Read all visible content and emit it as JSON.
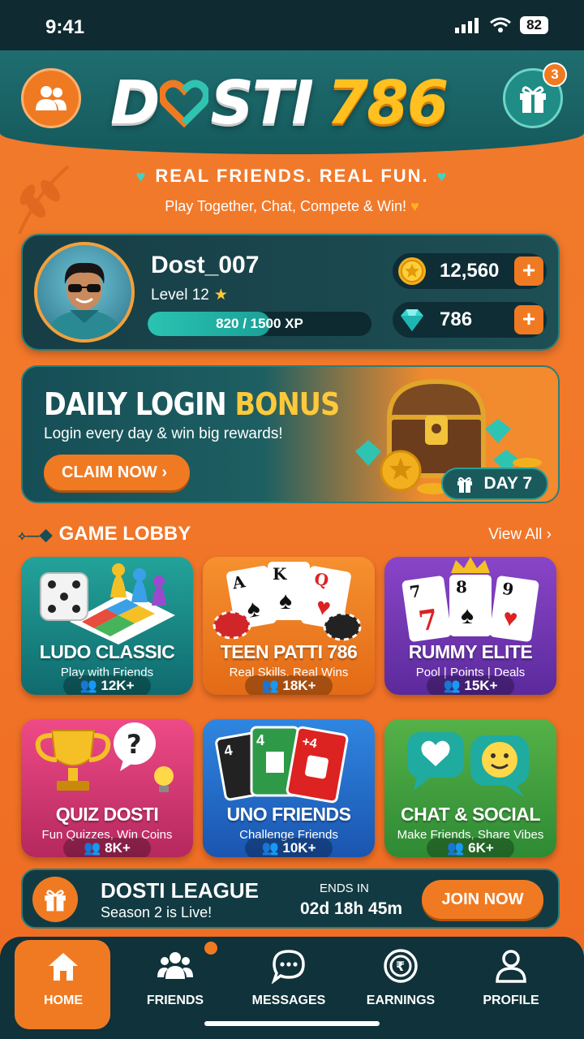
{
  "status_bar": {
    "time": "9:41",
    "battery": "82"
  },
  "header": {
    "logo_part1": "D",
    "logo_part2": "STI",
    "logo_number": "786",
    "gift_badge": "3"
  },
  "tagline": {
    "main": "REAL FRIENDS. REAL FUN.",
    "sub": "Play Together, Chat, Compete & Win!"
  },
  "profile": {
    "username": "Dost_007",
    "level": "Level 12",
    "xp_text": "820 / 1500 XP",
    "xp_progress": 0.547,
    "coins": "12,560",
    "gems": "786"
  },
  "daily_bonus": {
    "title_white": "DAILY LOGIN ",
    "title_yellow": "BONUS",
    "subtitle": "Login every day & win big rewards!",
    "claim_label": "CLAIM NOW",
    "day_label": "DAY 7"
  },
  "lobby": {
    "title": "GAME LOBBY",
    "view_all": "View All",
    "games": [
      {
        "name": "LUDO CLASSIC",
        "subtitle": "Play with Friends",
        "players": "12K+"
      },
      {
        "name": "TEEN PATTI 786",
        "subtitle": "Real Skills. Real Wins",
        "players": "18K+"
      },
      {
        "name": "RUMMY ELITE",
        "subtitle": "Pool | Points | Deals",
        "players": "15K+"
      },
      {
        "name": "QUIZ DOSTI",
        "subtitle": "Fun Quizzes, Win Coins",
        "players": "8K+"
      },
      {
        "name": "UNO FRIENDS",
        "subtitle": "Challenge Friends",
        "players": "10K+"
      },
      {
        "name": "CHAT & SOCIAL",
        "subtitle": "Make Friends, Share Vibes",
        "players": "6K+"
      }
    ]
  },
  "league": {
    "title": "DOSTI LEAGUE",
    "subtitle": "Season 2 is Live!",
    "ends_label": "ENDS IN",
    "countdown": "02d 18h 45m",
    "join_label": "JOIN NOW"
  },
  "nav": {
    "items": [
      {
        "label": "HOME"
      },
      {
        "label": "FRIENDS"
      },
      {
        "label": "MESSAGES"
      },
      {
        "label": "EARNINGS"
      },
      {
        "label": "PROFILE"
      }
    ]
  },
  "colors": {
    "accent": "#f07a22",
    "teal": "#1f6d6f",
    "gold": "#ffc020"
  }
}
